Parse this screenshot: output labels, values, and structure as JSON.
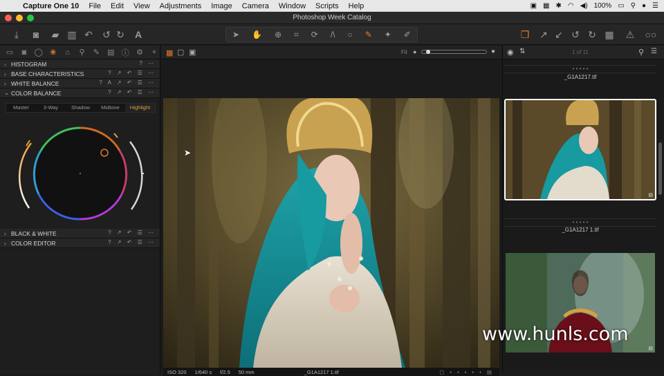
{
  "menubar": {
    "app": "Capture One 10",
    "items": [
      "File",
      "Edit",
      "View",
      "Adjustments",
      "Image",
      "Camera",
      "Window",
      "Scripts",
      "Help"
    ],
    "battery": "100%"
  },
  "window": {
    "title": "Photoshop Week Catalog"
  },
  "toolbar": {
    "left_icons": [
      "import-icon",
      "camera-icon",
      "export-icon",
      "trash-icon",
      "undo-icon",
      "redo-icon",
      "text-icon"
    ],
    "center_icons": [
      "cursor-icon",
      "hand-icon",
      "zoom-icon",
      "crop-icon",
      "rotate-icon",
      "keystone-icon",
      "circle-icon",
      "brush-icon",
      "erase-icon",
      "picker-icon"
    ],
    "right_icons": [
      "stack-icon",
      "copy-adjust-icon",
      "apply-adjust-icon",
      "rotate-left-icon",
      "rotate-right-icon",
      "grid-icon",
      "warning-icon",
      "glasses-icon"
    ]
  },
  "tool_tabs": [
    "library-icon",
    "capture-icon",
    "lens-icon",
    "color-icon",
    "composition-icon",
    "details-icon",
    "local-adjust-icon",
    "adjustments-icon",
    "metadata-icon",
    "output-icon",
    "batch-icon"
  ],
  "tools": {
    "histogram": "HISTOGRAM",
    "base": "BASE CHARACTERISTICS",
    "white_balance": "WHITE BALANCE",
    "color_balance": "COLOR BALANCE",
    "bw": "BLACK & WHITE",
    "color_editor": "COLOR EDITOR"
  },
  "color_balance_tabs": [
    "Master",
    "3-Way",
    "Shadow",
    "Midtone",
    "Highlight"
  ],
  "color_balance_active": "Highlight",
  "viewer": {
    "fit_label": "Fit",
    "status": {
      "iso": "ISO 320",
      "shutter": "1/640 s",
      "aperture": "f/2.5",
      "focal": "50 mm",
      "filename": "_G1A1217 1.tif"
    }
  },
  "browser": {
    "count": "1 of 11",
    "items": [
      {
        "name": "_G1A1217.tif"
      },
      {
        "name": "_G1A1217 1.tif"
      }
    ]
  },
  "watermark": "www.hunls.com",
  "colors": {
    "accent": "#e07a2e",
    "highlight_tab": "#e0a040"
  }
}
